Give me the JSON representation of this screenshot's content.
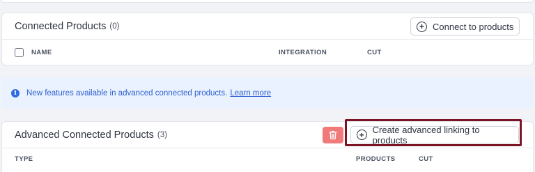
{
  "connected_products": {
    "title": "Connected Products",
    "count": "(0)",
    "connect_button_label": "Connect to products",
    "columns": [
      "NAME",
      "INTEGRATION",
      "CUT"
    ]
  },
  "banner": {
    "message": "New features available in advanced connected products.",
    "link_label": "Learn more"
  },
  "advanced_products": {
    "title": "Advanced Connected Products",
    "count": "(3)",
    "create_button_label": "Create advanced linking to products",
    "columns": [
      "TYPE",
      "PRODUCTS",
      "CUT"
    ]
  },
  "colors": {
    "accent_blue": "#2d5fcf",
    "delete_red": "#f07a7a",
    "highlight": "#7a1326"
  },
  "icons": {
    "add": "plus-circle-icon",
    "info": "info-icon",
    "delete": "trash-icon"
  }
}
